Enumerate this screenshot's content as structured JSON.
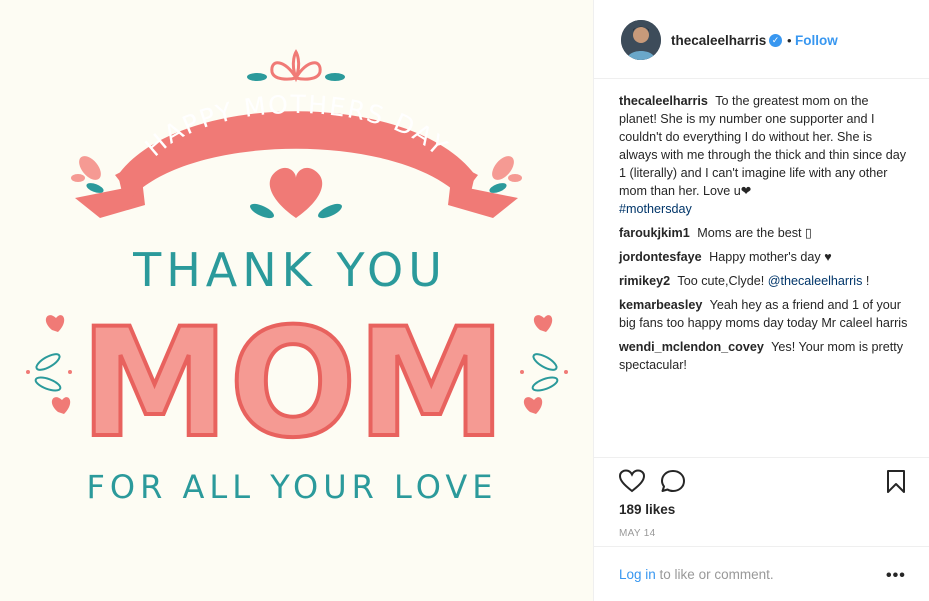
{
  "card": {
    "banner_text": "HAPPY MOTHERS DAY",
    "line1": "THANK YOU",
    "line2": "MOM",
    "line3": "FOR ALL YOUR LOVE"
  },
  "header": {
    "username": "thecaleelharris",
    "verified_mark": "✓",
    "separator": "•",
    "follow_label": "Follow"
  },
  "caption": {
    "user": "thecaleelharris",
    "text": "To the greatest mom on the planet! She is my number one supporter and I couldn't do everything I do without her. She is always with me through the thick and thin since day 1 (literally) and I can't imagine life with any other mom than her. Love u❤",
    "hashtag": "#mothersday"
  },
  "comments": [
    {
      "user": "faroukjkim1",
      "text": "Moms are the best ▯"
    },
    {
      "user": "jordontesfaye",
      "text": "Happy mother's day ♥"
    },
    {
      "user": "rimikey2",
      "text": "Too cute,Clyde!",
      "mention": "@thecaleelharris",
      "tail": "!"
    },
    {
      "user": "kemarbeasley",
      "text": "Yeah hey as a friend and 1 of your big fans too happy moms day today Mr caleel harris"
    },
    {
      "user": "wendi_mclendon_covey",
      "text": "Yes! Your mom is pretty spectacular!"
    }
  ],
  "actions": {
    "likes": "189 likes",
    "date": "MAY 14"
  },
  "footer": {
    "login_label": "Log in",
    "login_suffix": " to like or comment.",
    "more": "•••"
  },
  "colors": {
    "coral": "#f07a76",
    "coral_light": "#f59a93",
    "teal": "#2b9a9b",
    "link_blue": "#3897f0"
  }
}
